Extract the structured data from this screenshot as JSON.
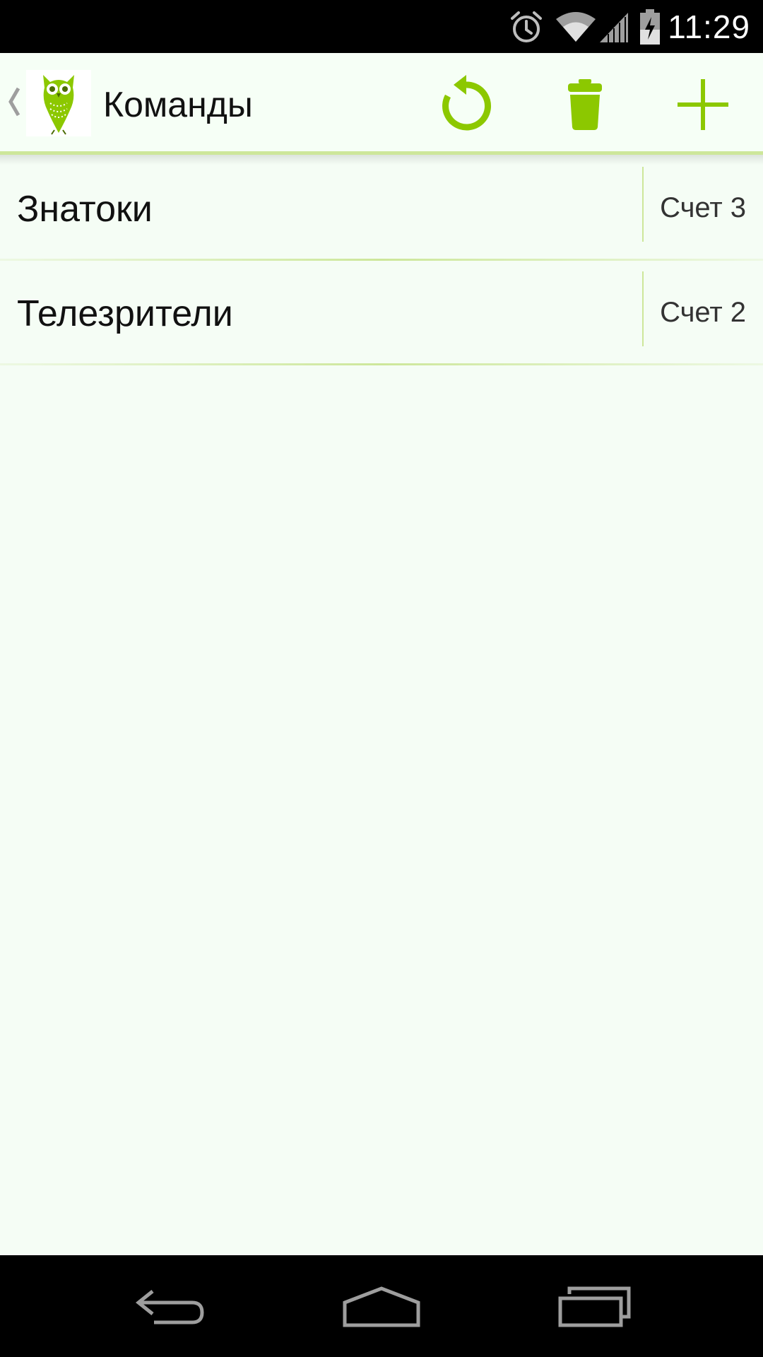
{
  "status_bar": {
    "time": "11:29",
    "icons": [
      "alarm-icon",
      "wifi-icon",
      "signal-icon",
      "battery-charging-icon"
    ]
  },
  "action_bar": {
    "title": "Команды",
    "actions": [
      "reset-icon",
      "trash-icon",
      "add-icon"
    ],
    "accent_color": "#8cc800"
  },
  "teams": [
    {
      "name": "Знатоки",
      "score": "Счет 3"
    },
    {
      "name": "Телезрители",
      "score": "Счет 2"
    }
  ],
  "nav_bar": {
    "buttons": [
      "back-icon",
      "home-icon",
      "recent-apps-icon"
    ]
  }
}
